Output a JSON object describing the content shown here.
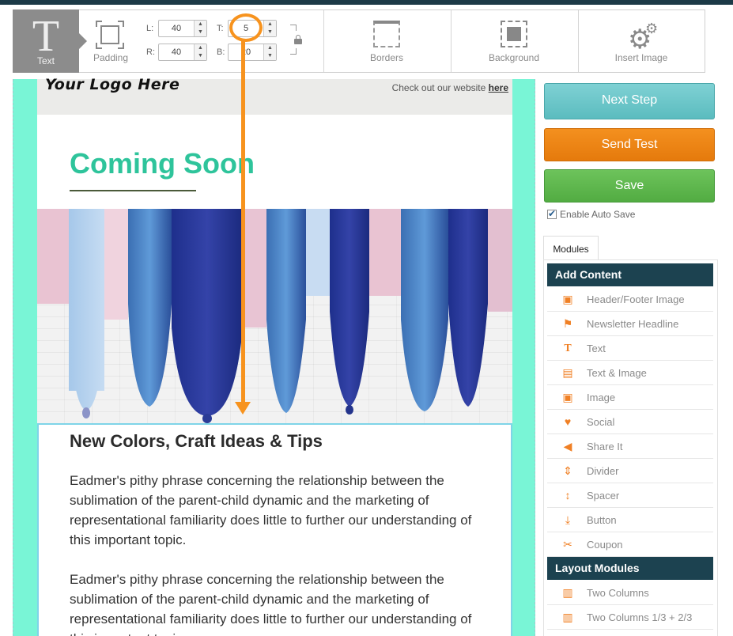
{
  "toolbar": {
    "text_tool_glyph": "T",
    "text_tool_label": "Text",
    "padding_label": "Padding",
    "pad_l_label": "L:",
    "pad_r_label": "R:",
    "pad_t_label": "T:",
    "pad_b_label": "B:",
    "pad_l_value": "40",
    "pad_r_value": "40",
    "pad_t_value": "5",
    "pad_b_value": "20",
    "borders_label": "Borders",
    "background_label": "Background",
    "insert_image_label": "Insert Image"
  },
  "email": {
    "logo": "Your Logo Here",
    "header_link_prefix": "Check out our website ",
    "header_link_text": "here",
    "headline": "Coming Soon",
    "section_heading": "New Colors, Craft Ideas & Tips",
    "paragraph_1": "Eadmer's pithy phrase concerning the relationship between the sublimation of the parent-child dynamic and the marketing of representational familiarity does little to further our understanding of this important topic.",
    "paragraph_2": "Eadmer's pithy phrase concerning the relationship between the sublimation of the parent-child dynamic and the marketing of representational familiarity does little to further our understanding of this important topic."
  },
  "actions": {
    "next_step": "Next Step",
    "send_test": "Send Test",
    "save": "Save",
    "auto_save_label": "Enable Auto Save",
    "auto_save_checked": true
  },
  "modules": {
    "tab_label": "Modules",
    "add_content_heading": "Add Content",
    "add_content_items": [
      {
        "label": "Header/Footer Image",
        "icon": "image-icon"
      },
      {
        "label": "Newsletter Headline",
        "icon": "flag-icon"
      },
      {
        "label": "Text",
        "icon": "text-icon"
      },
      {
        "label": "Text & Image",
        "icon": "text-image-icon"
      },
      {
        "label": "Image",
        "icon": "image-icon"
      },
      {
        "label": "Social",
        "icon": "heart-icon"
      },
      {
        "label": "Share It",
        "icon": "megaphone-icon"
      },
      {
        "label": "Divider",
        "icon": "divider-icon"
      },
      {
        "label": "Spacer",
        "icon": "spacer-icon"
      },
      {
        "label": "Button",
        "icon": "button-icon"
      },
      {
        "label": "Coupon",
        "icon": "scissors-icon"
      }
    ],
    "layout_heading": "Layout Modules",
    "layout_items": [
      {
        "label": "Two Columns",
        "icon": "two-columns-icon"
      },
      {
        "label": "Two Columns 1/3 + 2/3",
        "icon": "two-columns-icon"
      }
    ]
  },
  "colors": {
    "accent_teal": "#2ec49b",
    "canvas_bg": "#79f5d6",
    "orange": "#f7931e",
    "panel_dark": "#1c4250"
  }
}
